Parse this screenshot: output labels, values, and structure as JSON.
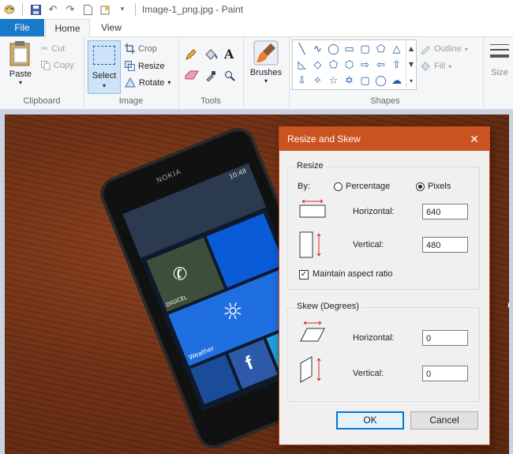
{
  "window": {
    "title": "Image-1_png.jpg - Paint"
  },
  "tabs": {
    "file": "File",
    "home": "Home",
    "view": "View"
  },
  "ribbon": {
    "clipboard": {
      "label": "Clipboard",
      "paste": "Paste",
      "cut": "Cut",
      "copy": "Copy"
    },
    "image": {
      "label": "Image",
      "select": "Select",
      "crop": "Crop",
      "resize": "Resize",
      "rotate": "Rotate"
    },
    "tools": {
      "label": "Tools"
    },
    "brushes": {
      "label": "Brushes"
    },
    "shapes": {
      "label": "Shapes",
      "outline": "Outline",
      "fill": "Fill"
    },
    "size": {
      "label": "Size"
    }
  },
  "phone": {
    "brand": "NOKIA",
    "time": "10:48",
    "carrier": "DIGICEL",
    "weather": "Weather"
  },
  "dialog": {
    "title": "Resize and Skew",
    "close": "✕",
    "resize": {
      "legend": "Resize",
      "by_label": "By:",
      "option_percentage": "Percentage",
      "option_pixels": "Pixels",
      "selected": "Pixels",
      "horizontal_label": "Horizontal:",
      "horizontal_value": "640",
      "vertical_label": "Vertical:",
      "vertical_value": "480",
      "maintain_label": "Maintain aspect ratio",
      "maintain_checked": true
    },
    "skew": {
      "legend": "Skew (Degrees)",
      "horizontal_label": "Horizontal:",
      "horizontal_value": "0",
      "vertical_label": "Vertical:",
      "vertical_value": "0"
    },
    "ok": "OK",
    "cancel": "Cancel"
  },
  "colors": {
    "accent": "#1979ca",
    "dialog_title": "#ca5421",
    "ribbon_bg": "#f5f6f7"
  }
}
